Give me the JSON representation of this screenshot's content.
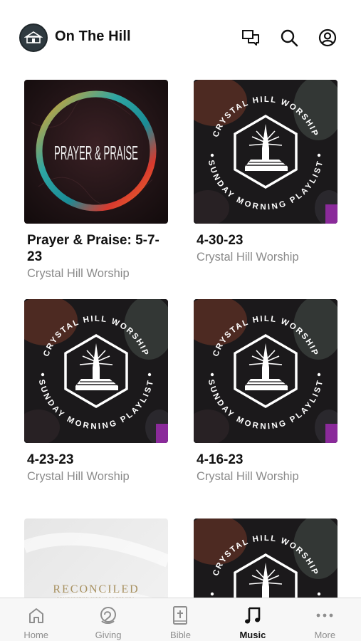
{
  "header": {
    "title": "On The Hill",
    "icons": [
      "church-logo",
      "chat-icon",
      "search-icon",
      "profile-icon"
    ]
  },
  "albums": [
    {
      "title": "Prayer & Praise: 5-7-23",
      "artist": "Crystal Hill Worship",
      "cover_text": "PRAYER & PRAISE"
    },
    {
      "title": "4-30-23",
      "artist": "Crystal Hill Worship",
      "cover_text": "CRYSTAL HILL WORSHIP · SUNDAY MORNING PLAYLIST"
    },
    {
      "title": "4-23-23",
      "artist": "Crystal Hill Worship",
      "cover_text": "CRYSTAL HILL WORSHIP · SUNDAY MORNING PLAYLIST"
    },
    {
      "title": "4-16-23",
      "artist": "Crystal Hill Worship",
      "cover_text": "CRYSTAL HILL WORSHIP · SUNDAY MORNING PLAYLIST"
    },
    {
      "cover_title": "RECONCILED",
      "cover_subtitle": "RESURRECTION SUNDAY ON THE HILL"
    },
    {
      "cover_text": "CRYSTAL HILL WORSHIP · SUNDAY MORNING PLAYLIST"
    }
  ],
  "cover_art": {
    "ring_top": "CRYSTAL HILL WORSHIP",
    "ring_bottom": "SUNDAY MORNING PLAYLIST"
  },
  "tabs": [
    {
      "label": "Home",
      "icon": "home-icon",
      "active": false
    },
    {
      "label": "Giving",
      "icon": "giving-icon",
      "active": false
    },
    {
      "label": "Bible",
      "icon": "bible-icon",
      "active": false
    },
    {
      "label": "Music",
      "icon": "music-note-icon",
      "active": true
    },
    {
      "label": "More",
      "icon": "more-dots-icon",
      "active": false
    }
  ],
  "colors": {
    "active_tab": "#111111",
    "inactive_tab": "#8e8e8e",
    "subtitle": "#8a8a8a"
  }
}
